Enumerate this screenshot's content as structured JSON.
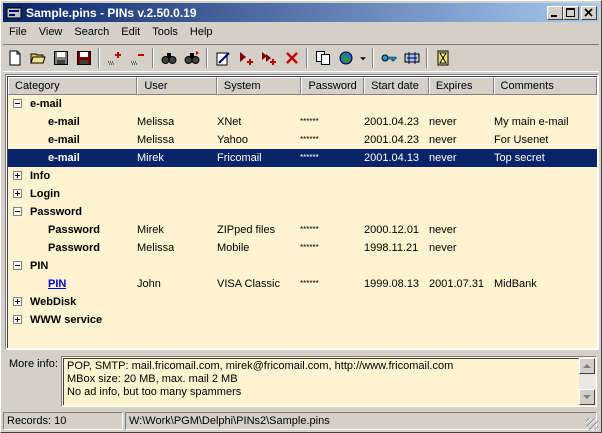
{
  "window": {
    "title": "Sample.pins - PINs v.2.50.0.19"
  },
  "menu": [
    "File",
    "View",
    "Search",
    "Edit",
    "Tools",
    "Help"
  ],
  "toolbar": {
    "icons": [
      "new-file-icon",
      "open-folder-icon",
      "save-icon",
      "save-as-icon",
      "add-group-icon",
      "delete-group-icon",
      "find-icon",
      "find-next-icon",
      "edit-record-icon",
      "add-record-icon",
      "add-child-icon",
      "delete-record-icon",
      "copy-icon",
      "browse-web-icon",
      "dropdown-arrow-icon",
      "key-icon",
      "password-generator-icon",
      "timer-icon"
    ]
  },
  "columns": [
    "Category",
    "User",
    "System",
    "Password",
    "Start date",
    "Expires",
    "Comments"
  ],
  "rows": [
    {
      "type": "group",
      "label": "e-mail",
      "expanded": true
    },
    {
      "type": "item",
      "category": "e-mail",
      "user": "Melissa",
      "system": "XNet",
      "password": "******",
      "start": "2001.04.23",
      "expires": "never",
      "comments": "My main e-mail",
      "selected": false,
      "link": false
    },
    {
      "type": "item",
      "category": "e-mail",
      "user": "Melissa",
      "system": "Yahoo",
      "password": "******",
      "start": "2001.04.23",
      "expires": "never",
      "comments": "For Usenet",
      "selected": false,
      "link": false
    },
    {
      "type": "item",
      "category": "e-mail",
      "user": "Mirek",
      "system": "Fricomail",
      "password": "******",
      "start": "2001.04.13",
      "expires": "never",
      "comments": "Top secret",
      "selected": true,
      "link": false
    },
    {
      "type": "group",
      "label": "Info",
      "expanded": false
    },
    {
      "type": "group",
      "label": "Login",
      "expanded": false
    },
    {
      "type": "group",
      "label": "Password",
      "expanded": true
    },
    {
      "type": "item",
      "category": "Password",
      "user": "Mirek",
      "system": "ZIPped files",
      "password": "******",
      "start": "2000.12.01",
      "expires": "never",
      "comments": "",
      "selected": false,
      "link": false
    },
    {
      "type": "item",
      "category": "Password",
      "user": "Melissa",
      "system": "Mobile",
      "password": "******",
      "start": "1998.11.21",
      "expires": "never",
      "comments": "",
      "selected": false,
      "link": false
    },
    {
      "type": "group",
      "label": "PIN",
      "expanded": true
    },
    {
      "type": "item",
      "category": "PIN",
      "user": "John",
      "system": "VISA Classic",
      "password": "******",
      "start": "1999.08.13",
      "expires": "2001.07.31",
      "comments": "MidBank",
      "selected": false,
      "link": true
    },
    {
      "type": "group",
      "label": "WebDisk",
      "expanded": false
    },
    {
      "type": "group",
      "label": "WWW service",
      "expanded": false
    }
  ],
  "more_info": {
    "label": "More info:",
    "lines": [
      "POP, SMTP: mail.fricomail.com,  mirek@fricomail.com,  http://www.fricomail.com",
      "MBox size: 20 MB, max. mail 2 MB",
      "No ad info, but too many spammers"
    ]
  },
  "status": {
    "records": "Records: 10",
    "path": "W:\\Work\\PGM\\Delphi\\PINs2\\Sample.pins"
  },
  "colors": {
    "title_start": "#0a246a",
    "title_end": "#a6caf0",
    "list_bg": "#fdf3d0",
    "selection": "#0a246a",
    "link": "#0000cc"
  }
}
